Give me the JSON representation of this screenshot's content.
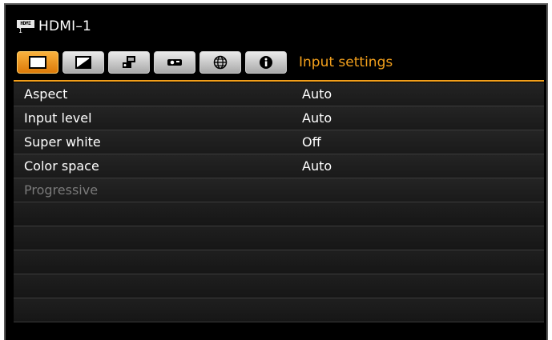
{
  "title": "HDMI–1",
  "source_badge": {
    "text": "HDMI",
    "number": "1"
  },
  "tabs": [
    {
      "icon": "screen-icon",
      "active": true
    },
    {
      "icon": "image-adjust-icon",
      "active": false
    },
    {
      "icon": "display-settings-icon",
      "active": false
    },
    {
      "icon": "projector-icon",
      "active": false
    },
    {
      "icon": "network-globe-icon",
      "active": false
    },
    {
      "icon": "info-icon",
      "active": false
    }
  ],
  "section_title": "Input settings",
  "menu": [
    {
      "label": "Aspect",
      "value": "Auto",
      "enabled": true
    },
    {
      "label": "Input level",
      "value": "Auto",
      "enabled": true
    },
    {
      "label": "Super white",
      "value": "Off",
      "enabled": true
    },
    {
      "label": "Color space",
      "value": "Auto",
      "enabled": true
    },
    {
      "label": "Progressive",
      "value": "",
      "enabled": false
    }
  ],
  "colors": {
    "accent": "#f3a01c",
    "background": "#000000",
    "disabled_text": "#7a7a7a"
  }
}
